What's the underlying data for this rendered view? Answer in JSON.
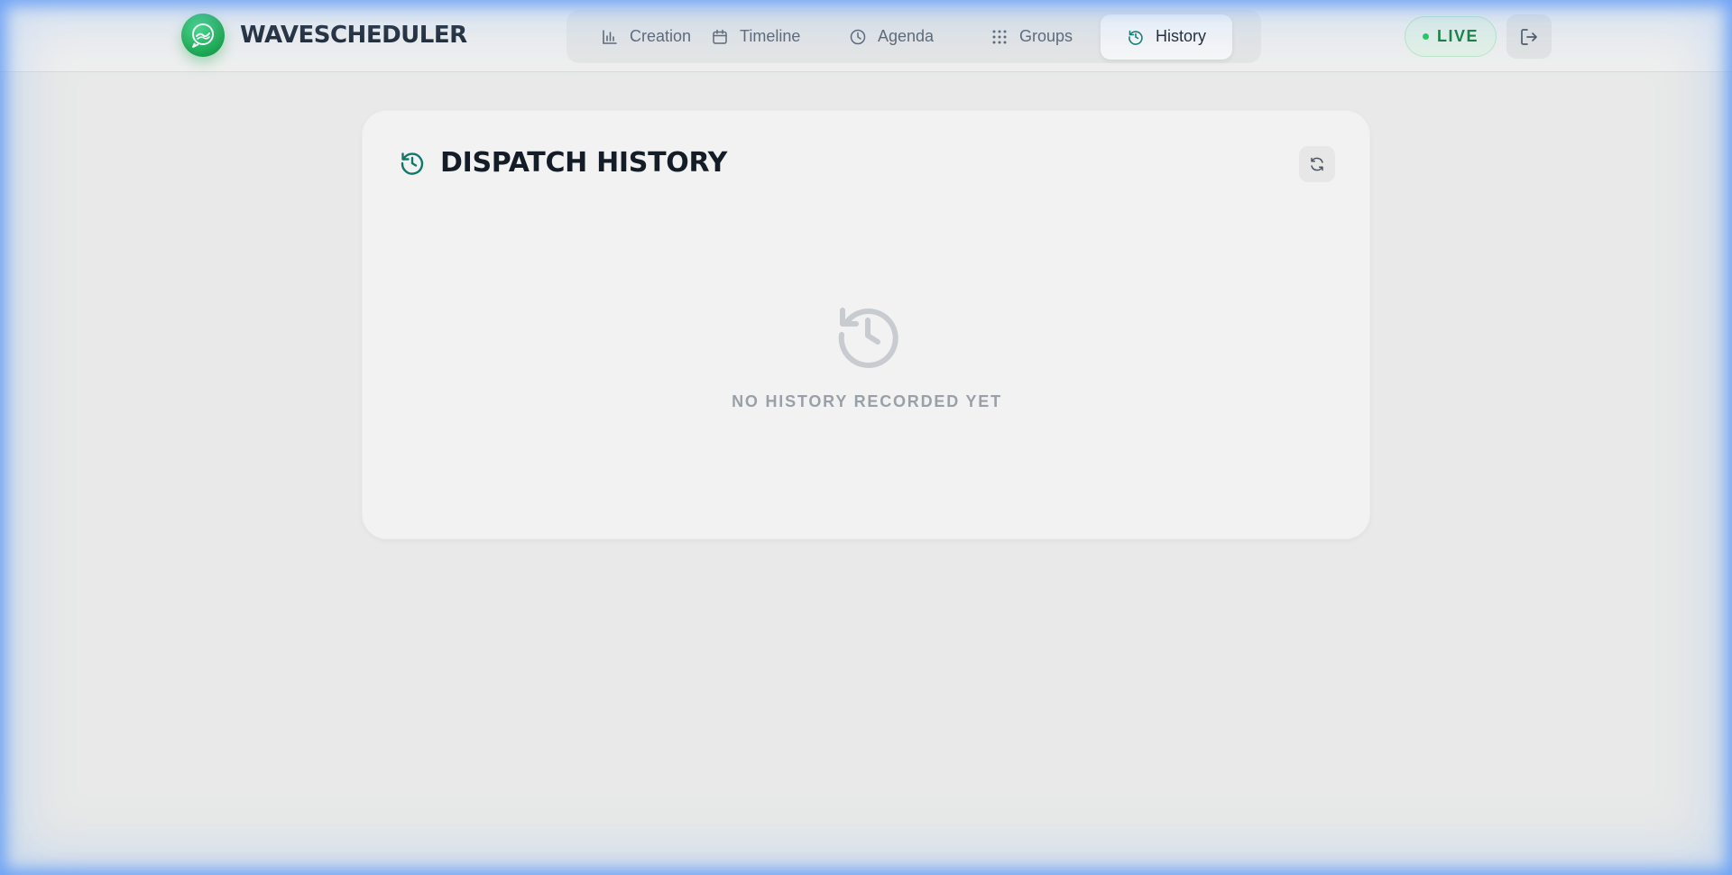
{
  "app": {
    "name": "WAVESCHEDULER",
    "accent": "#0f7a6b"
  },
  "nav": {
    "tabs": [
      {
        "label": "Creation",
        "icon": "bar-chart-icon",
        "active": false
      },
      {
        "label": "Timeline",
        "icon": "calendar-icon",
        "active": false
      },
      {
        "label": "Agenda",
        "icon": "clock-icon",
        "active": false
      },
      {
        "label": "Groups",
        "icon": "grid-dots-icon",
        "active": false
      },
      {
        "label": "History",
        "icon": "history-icon",
        "active": true
      }
    ]
  },
  "status": {
    "label": "LIVE",
    "color": "#22c55e"
  },
  "header_actions": {
    "logout_icon": "logout-icon"
  },
  "main": {
    "title": "DISPATCH HISTORY",
    "refresh_icon": "refresh-icon",
    "empty_state": {
      "icon": "history-icon",
      "text": "NO HISTORY RECORDED YET"
    }
  }
}
